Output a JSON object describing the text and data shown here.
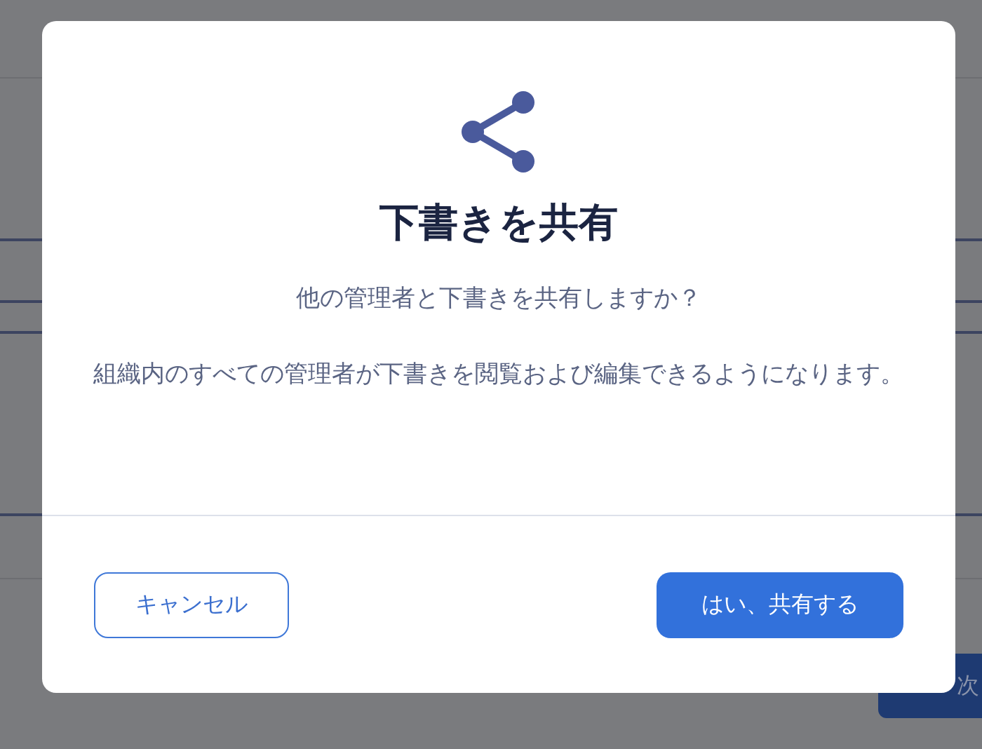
{
  "background": {
    "next_button": {
      "label": "次"
    }
  },
  "dialog": {
    "title": "下書きを共有",
    "question": "他の管理者と下書きを共有しますか？",
    "description": "組織内のすべての管理者が下書きを閲覧および編集できるようになります。",
    "buttons": [
      {
        "kind": "secondary",
        "label": "キャンセル"
      },
      {
        "kind": "primary",
        "label": "はい、共有する"
      }
    ]
  }
}
